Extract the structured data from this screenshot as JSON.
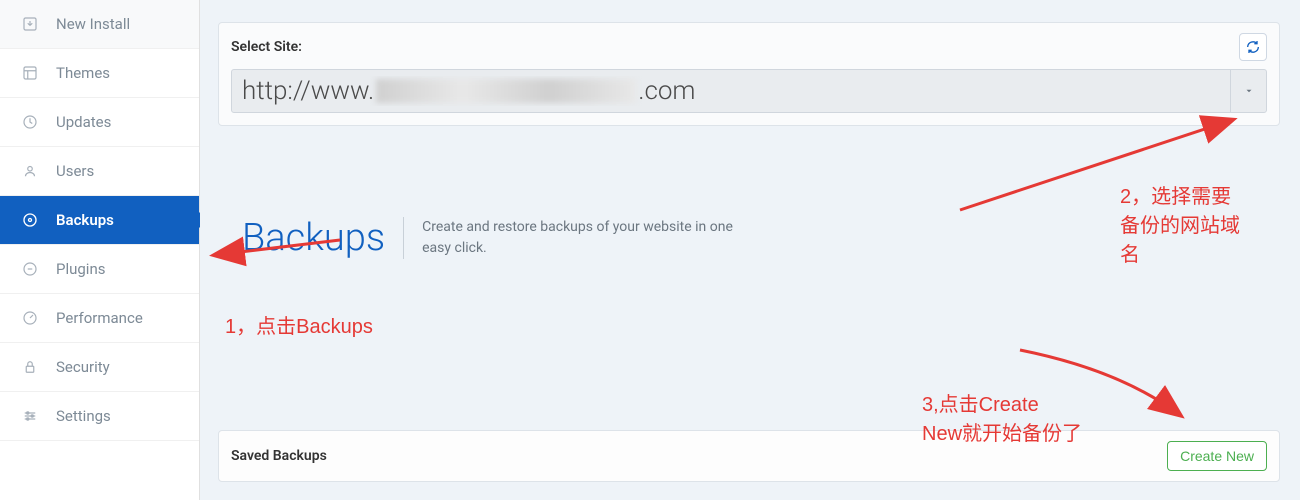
{
  "sidebar": {
    "items": [
      {
        "label": "New Install",
        "icon": "download-icon"
      },
      {
        "label": "Themes",
        "icon": "themes-icon"
      },
      {
        "label": "Updates",
        "icon": "updates-icon"
      },
      {
        "label": "Users",
        "icon": "users-icon"
      },
      {
        "label": "Backups",
        "icon": "backups-icon"
      },
      {
        "label": "Plugins",
        "icon": "plugins-icon"
      },
      {
        "label": "Performance",
        "icon": "performance-icon"
      },
      {
        "label": "Security",
        "icon": "security-icon"
      },
      {
        "label": "Settings",
        "icon": "settings-icon"
      }
    ]
  },
  "selectSite": {
    "label": "Select Site:",
    "urlPrefix": "http://www.",
    "urlSuffix": ".com"
  },
  "backups": {
    "title": "Backups",
    "description": "Create and restore backups of your website in one easy click."
  },
  "savedBackups": {
    "label": "Saved Backups",
    "createNew": "Create New"
  },
  "annotations": {
    "a1": "1，点击Backups",
    "a2": "2，选择需要\n备份的网站域\n名",
    "a3": "3,点击Create\nNew就开始备份了"
  }
}
